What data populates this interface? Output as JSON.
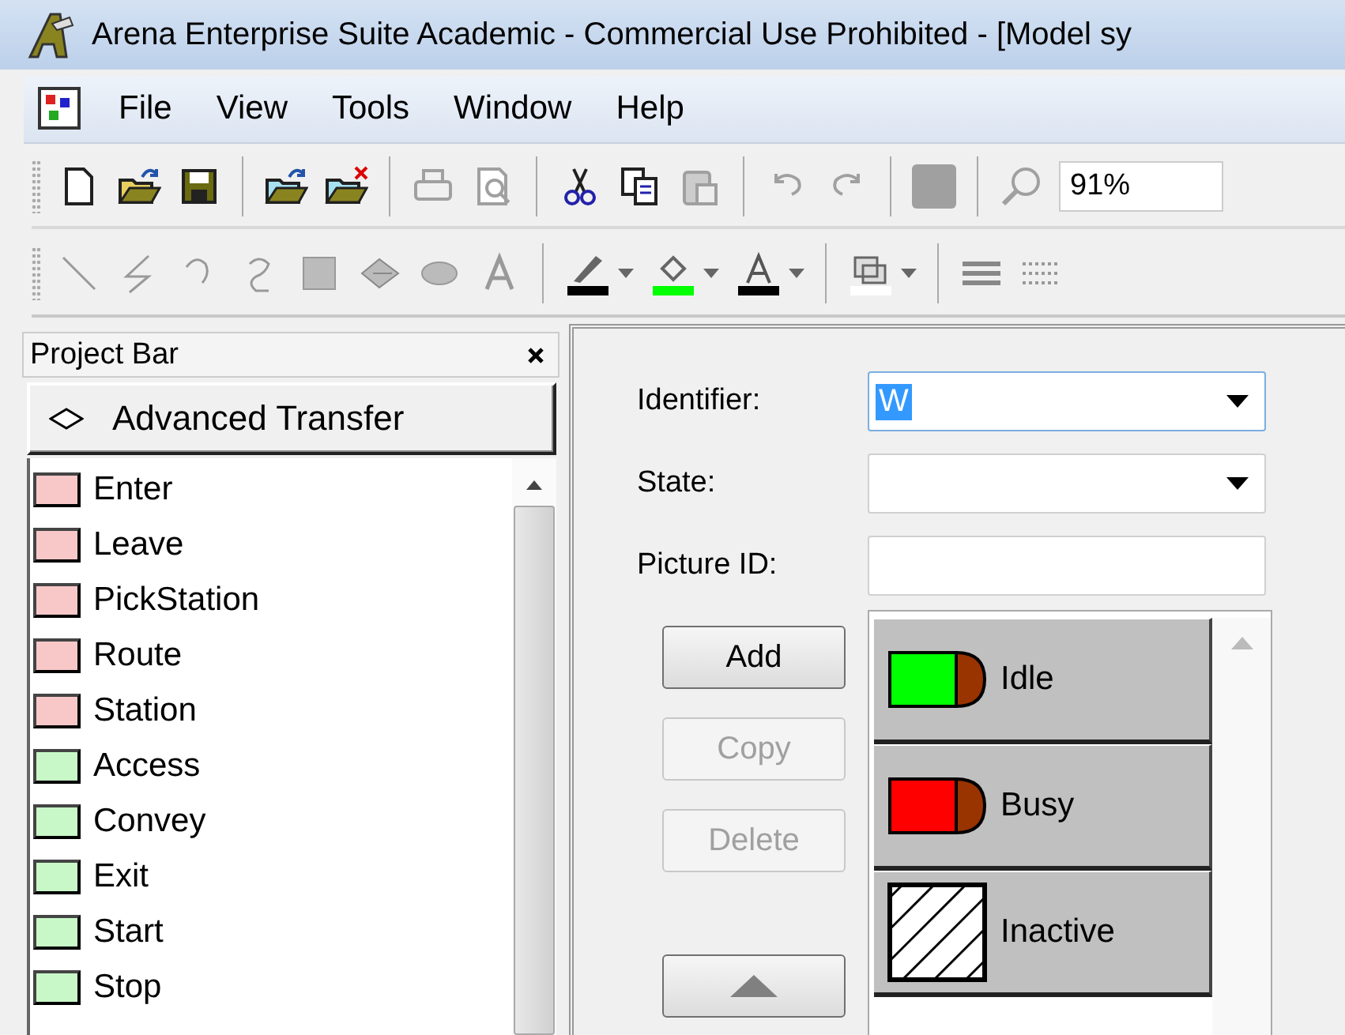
{
  "window": {
    "title": "Arena Enterprise Suite Academic - Commercial Use Prohibited - [Model sy"
  },
  "menu": [
    "File",
    "View",
    "Tools",
    "Window",
    "Help"
  ],
  "toolbar": [
    {
      "kind": "new",
      "disabled": false
    },
    {
      "kind": "open",
      "disabled": false
    },
    {
      "kind": "save",
      "disabled": false
    },
    {
      "kind": "sep"
    },
    {
      "kind": "open-template",
      "disabled": false
    },
    {
      "kind": "close-template",
      "disabled": false
    },
    {
      "kind": "sep"
    },
    {
      "kind": "print",
      "disabled": true
    },
    {
      "kind": "preview",
      "disabled": true
    },
    {
      "kind": "sep"
    },
    {
      "kind": "cut",
      "disabled": false
    },
    {
      "kind": "copy",
      "disabled": false
    },
    {
      "kind": "paste",
      "disabled": true
    },
    {
      "kind": "sep"
    },
    {
      "kind": "undo",
      "disabled": true
    },
    {
      "kind": "redo",
      "disabled": true
    },
    {
      "kind": "sep"
    },
    {
      "kind": "swatch",
      "disabled": true
    },
    {
      "kind": "sep"
    },
    {
      "kind": "zoom",
      "disabled": true
    }
  ],
  "zoom": {
    "value": "91%"
  },
  "drawing_toolbar": [
    {
      "kind": "line"
    },
    {
      "kind": "polyline"
    },
    {
      "kind": "arc"
    },
    {
      "kind": "bezier"
    },
    {
      "kind": "rectangle"
    },
    {
      "kind": "polygon"
    },
    {
      "kind": "ellipse"
    },
    {
      "kind": "text"
    },
    {
      "kind": "sep"
    },
    {
      "kind": "line-color",
      "color": "#000000"
    },
    {
      "kind": "fill-color",
      "color": "#00ff00"
    },
    {
      "kind": "text-color",
      "color": "#000000"
    },
    {
      "kind": "sep"
    },
    {
      "kind": "background",
      "color": "#ffffff"
    },
    {
      "kind": "sep"
    },
    {
      "kind": "line-width"
    },
    {
      "kind": "line-style"
    }
  ],
  "project_bar": {
    "title": "Project Bar",
    "panel": "Advanced Transfer",
    "modules": [
      {
        "label": "Enter",
        "color": "#f8c8c8"
      },
      {
        "label": "Leave",
        "color": "#f8c8c8"
      },
      {
        "label": "PickStation",
        "color": "#f8c8c8"
      },
      {
        "label": "Route",
        "color": "#f8c8c8"
      },
      {
        "label": "Station",
        "color": "#f8c8c8"
      },
      {
        "label": "Access",
        "color": "#c8f8c8"
      },
      {
        "label": "Convey",
        "color": "#c8f8c8"
      },
      {
        "label": "Exit",
        "color": "#c8f8c8"
      },
      {
        "label": "Start",
        "color": "#c8f8c8"
      },
      {
        "label": "Stop",
        "color": "#c8f8c8"
      }
    ]
  },
  "form": {
    "fields": [
      {
        "label": "Identifier:",
        "kind": "dropdown",
        "value": "W",
        "focused": true
      },
      {
        "label": "State:",
        "kind": "dropdown",
        "focused": false
      },
      {
        "label": "Picture ID:",
        "kind": "text",
        "focused": false
      }
    ],
    "buttons": [
      {
        "kind": "text",
        "label": "Add",
        "disabled": false
      },
      {
        "kind": "text",
        "label": "Copy",
        "disabled": true
      },
      {
        "kind": "text",
        "label": "Delete",
        "disabled": true
      },
      {
        "kind": "move-up",
        "disabled": false
      }
    ],
    "pictures": [
      {
        "label": "Idle",
        "kind": "machine",
        "color": "#00ff00"
      },
      {
        "label": "Busy",
        "kind": "machine",
        "color": "#ff0000"
      },
      {
        "label": "Inactive",
        "kind": "hatched"
      }
    ]
  }
}
